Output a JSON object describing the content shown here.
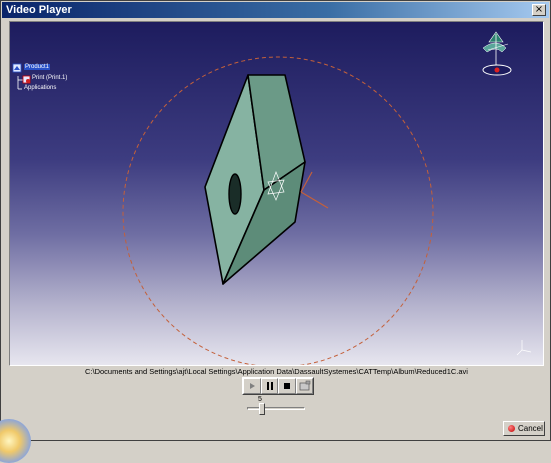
{
  "window": {
    "title": "Video Player"
  },
  "tree": {
    "root": "Product1",
    "child": "Print (Print.1)",
    "applications": "Applications"
  },
  "file_path": "C:\\Documents and Settings\\ajt\\Local Settings\\Application Data\\DassaultSystemes\\CATTemp\\Album\\Reduced1C.avi",
  "controls": {
    "play_icon": "play-icon",
    "pause_icon": "pause-icon",
    "stop_icon": "stop-icon",
    "capture_icon": "capture-icon"
  },
  "slider": {
    "value": "5"
  },
  "cancel_label": "Cancel",
  "colors": {
    "part_face": "#6b9a87",
    "part_face_light": "#86b3a2",
    "part_face_dark": "#4f7d6b",
    "circle": "#c4603a",
    "title_bar": "#0a246a"
  }
}
